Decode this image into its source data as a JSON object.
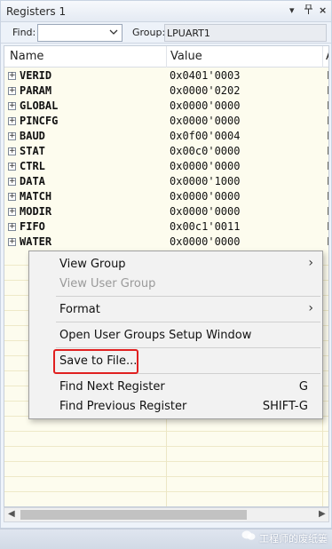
{
  "window": {
    "title": "Registers 1",
    "controls": {
      "dropdown": "▾",
      "pin": "ꟷ",
      "close": "×"
    }
  },
  "toolbar": {
    "find_label": "Find:",
    "find_value": "",
    "group_label": "Group:",
    "group_value": "LPUART1"
  },
  "table": {
    "columns": [
      "Name",
      "Value",
      "A"
    ],
    "rows": [
      {
        "name": "VERID",
        "value": "0x0401'0003",
        "access": "F"
      },
      {
        "name": "PARAM",
        "value": "0x0000'0202",
        "access": "F"
      },
      {
        "name": "GLOBAL",
        "value": "0x0000'0000",
        "access": "F"
      },
      {
        "name": "PINCFG",
        "value": "0x0000'0000",
        "access": "F"
      },
      {
        "name": "BAUD",
        "value": "0x0f00'0004",
        "access": "F"
      },
      {
        "name": "STAT",
        "value": "0x00c0'0000",
        "access": "F"
      },
      {
        "name": "CTRL",
        "value": "0x0000'0000",
        "access": "F"
      },
      {
        "name": "DATA",
        "value": "0x0000'1000",
        "access": "F"
      },
      {
        "name": "MATCH",
        "value": "0x0000'0000",
        "access": "F"
      },
      {
        "name": "MODIR",
        "value": "0x0000'0000",
        "access": "F"
      },
      {
        "name": "FIFO",
        "value": "0x00c1'0011",
        "access": "F"
      },
      {
        "name": "WATER",
        "value": "0x0000'0000",
        "access": "F"
      }
    ]
  },
  "context_menu": {
    "items": [
      {
        "label": "View Group",
        "shortcut": "",
        "submenu": true,
        "disabled": false
      },
      {
        "label": "View User Group",
        "shortcut": "",
        "submenu": false,
        "disabled": true
      },
      {
        "label": "Format",
        "shortcut": "",
        "submenu": true,
        "disabled": false
      },
      {
        "label": "Open User Groups Setup Window",
        "shortcut": "",
        "submenu": false,
        "disabled": false
      },
      {
        "label": "Save to File...",
        "shortcut": "",
        "submenu": false,
        "disabled": false,
        "highlighted": true
      },
      {
        "label": "Find Next Register",
        "shortcut": "G",
        "submenu": false,
        "disabled": false
      },
      {
        "label": "Find Previous Register",
        "shortcut": "SHIFT-G",
        "submenu": false,
        "disabled": false
      }
    ],
    "submenu_arrow": "›",
    "highlight_color": "#e02020"
  },
  "watermark": {
    "text": "工程师的废纸篓",
    "icon": "wechat-icon"
  }
}
